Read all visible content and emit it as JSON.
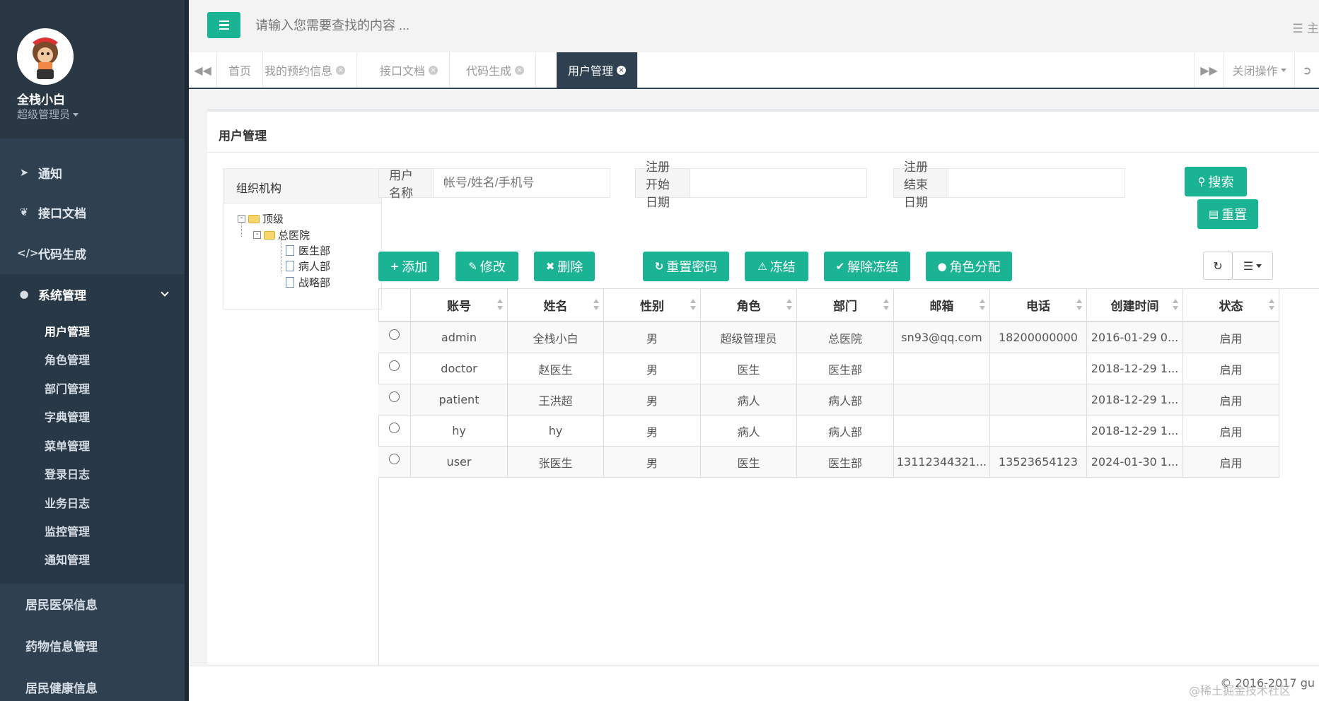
{
  "sidebar": {
    "profile_name": "全栈小白",
    "profile_role": "超级管理员",
    "nav": [
      {
        "label": "通知",
        "icon": "rocket-icon"
      },
      {
        "label": "接口文档",
        "icon": "leaf-icon"
      },
      {
        "label": "代码生成",
        "icon": "code-icon"
      },
      {
        "label": "系统管理",
        "icon": "user-icon"
      }
    ],
    "sub_items": [
      "用户管理",
      "角色管理",
      "部门管理",
      "字典管理",
      "菜单管理",
      "登录日志",
      "业务日志",
      "监控管理",
      "通知管理"
    ],
    "bottom_items": [
      "居民医保信息",
      "药物信息管理",
      "居民健康信息"
    ]
  },
  "topbar": {
    "search_placeholder": "请输入您需要查找的内容 ...",
    "right_text": "主"
  },
  "tabs": {
    "items": [
      "首页",
      "我的预约信息",
      "接口文档",
      "代码生成",
      "用户管理"
    ],
    "active": "用户管理",
    "close_ops": "关闭操作"
  },
  "panel": {
    "title": "用户管理",
    "org_title": "组织机构",
    "tree": {
      "root": "顶级",
      "child": "总医院",
      "leaves": [
        "医生部",
        "病人部",
        "战略部"
      ]
    }
  },
  "filters": {
    "username_label": "用户名称",
    "username_placeholder": "帐号/姓名/手机号",
    "start_label": "注册开始日期",
    "end_label": "注册结束日期",
    "search_btn": "搜索",
    "reset_btn": "重置"
  },
  "toolbar": {
    "add": "添加",
    "edit": "修改",
    "delete": "删除",
    "reset_pwd": "重置密码",
    "freeze": "冻结",
    "unfreeze": "解除冻结",
    "assign_role": "角色分配"
  },
  "table": {
    "headers": [
      "账号",
      "姓名",
      "性别",
      "角色",
      "部门",
      "邮箱",
      "电话",
      "创建时间",
      "状态"
    ],
    "rows": [
      [
        "admin",
        "全栈小白",
        "男",
        "超级管理员",
        "总医院",
        "sn93@qq.com",
        "18200000000",
        "2016-01-29 0...",
        "启用"
      ],
      [
        "doctor",
        "赵医生",
        "男",
        "医生",
        "医生部",
        "",
        "",
        "2018-12-29 1...",
        "启用"
      ],
      [
        "patient",
        "王洪超",
        "男",
        "病人",
        "病人部",
        "",
        "",
        "2018-12-29 1...",
        "启用"
      ],
      [
        "hy",
        "hy",
        "男",
        "病人",
        "病人部",
        "",
        "",
        "2018-12-29 1...",
        "启用"
      ],
      [
        "user",
        "张医生",
        "男",
        "医生",
        "医生部",
        "13112344321...",
        "13523654123",
        "2024-01-30 1...",
        "启用"
      ]
    ]
  },
  "footer": {
    "copyright": "© 2016-2017 gu",
    "watermark": "@稀土掘金技术社区"
  },
  "colors": {
    "accent": "#1ab394",
    "sidebar": "#2f4050"
  }
}
